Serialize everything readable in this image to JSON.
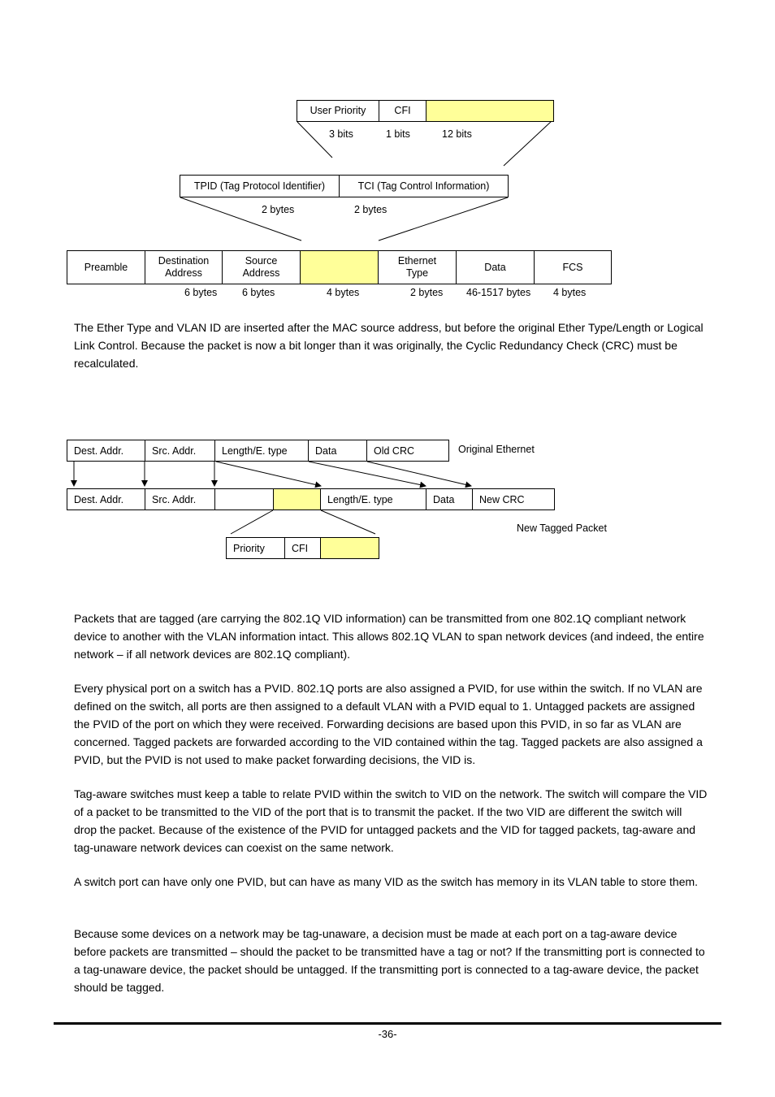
{
  "diagram1": {
    "tci_fields": [
      {
        "label": "User Priority",
        "size": "3 bits"
      },
      {
        "label": "CFI",
        "size": "1 bits"
      },
      {
        "label": "",
        "size": "12 bits",
        "highlight_color": "#ffff99"
      }
    ],
    "tag_fields": [
      {
        "label": "TPID (Tag Protocol Identifier)",
        "size": "2 bytes"
      },
      {
        "label": "TCI (Tag Control Information)",
        "size": "2 bytes"
      }
    ],
    "frame_fields": [
      {
        "label": "Preamble",
        "size": ""
      },
      {
        "label": "Destination\nAddress",
        "size": "6 bytes"
      },
      {
        "label": "Source\nAddress",
        "size": "6 bytes"
      },
      {
        "label": "",
        "size": "4 bytes",
        "highlight_color": "#ffff99"
      },
      {
        "label": "Ethernet\nType",
        "size": "2 bytes"
      },
      {
        "label": "Data",
        "size": "46-1517 bytes"
      },
      {
        "label": "FCS",
        "size": "4 bytes"
      }
    ]
  },
  "paragraph1": "The Ether Type and VLAN ID are inserted after the MAC source address, but before the original Ether Type/Length or Logical Link Control. Because the packet is now a bit longer than it was originally, the Cyclic Redundancy Check (CRC) must be recalculated.",
  "diagram2": {
    "original_label": "Original Ethernet",
    "tagged_label": "New Tagged Packet",
    "original_fields": [
      "Dest. Addr.",
      "Src. Addr.",
      "Length/E. type",
      "Data",
      "Old CRC"
    ],
    "tagged_fields": [
      "Dest. Addr.",
      "Src. Addr.",
      "",
      "",
      "Length/E. type",
      "Data",
      "New CRC"
    ],
    "tag_detail_fields": [
      "Priority",
      "CFI",
      ""
    ],
    "highlight_color": "#ffff99"
  },
  "paragraphs": [
    "Packets that are tagged (are carrying the 802.1Q VID information) can be transmitted from one 802.1Q compliant network device to another with the VLAN information intact. This allows 802.1Q VLAN to span network devices (and indeed, the entire network – if all network devices are 802.1Q compliant).",
    "Every physical port on a switch has a PVID. 802.1Q ports are also assigned a PVID, for use within the switch. If no VLAN are defined on the switch, all ports are then assigned to a default VLAN with a PVID equal to 1. Untagged packets are assigned the PVID of the port on which they were received. Forwarding decisions are based upon this PVID, in so far as VLAN are concerned. Tagged packets are forwarded according to the VID contained within the tag. Tagged packets are also assigned a PVID, but the PVID is not used to make packet forwarding decisions, the VID is.",
    "Tag-aware switches must keep a table to relate PVID within the switch to VID on the network. The switch will compare the VID of a packet to be transmitted to the VID of the port that is to transmit the packet. If the two VID are different the switch will drop the packet. Because of the existence of the PVID for untagged packets and the VID for tagged packets, tag-aware and tag-unaware network devices can coexist on the same network.",
    "A switch port can have only one PVID, but can have as many VID as the switch has memory in its VLAN table to store them.",
    "Because some devices on a network may be tag-unaware, a decision must be made at each port on a tag-aware device before packets are transmitted – should the packet to be transmitted have a tag or not? If the transmitting port is connected to a tag-unaware device, the packet should be untagged. If the transmitting port is connected to a tag-aware device, the packet should be tagged."
  ],
  "footer": {
    "page_number": "-36-"
  }
}
